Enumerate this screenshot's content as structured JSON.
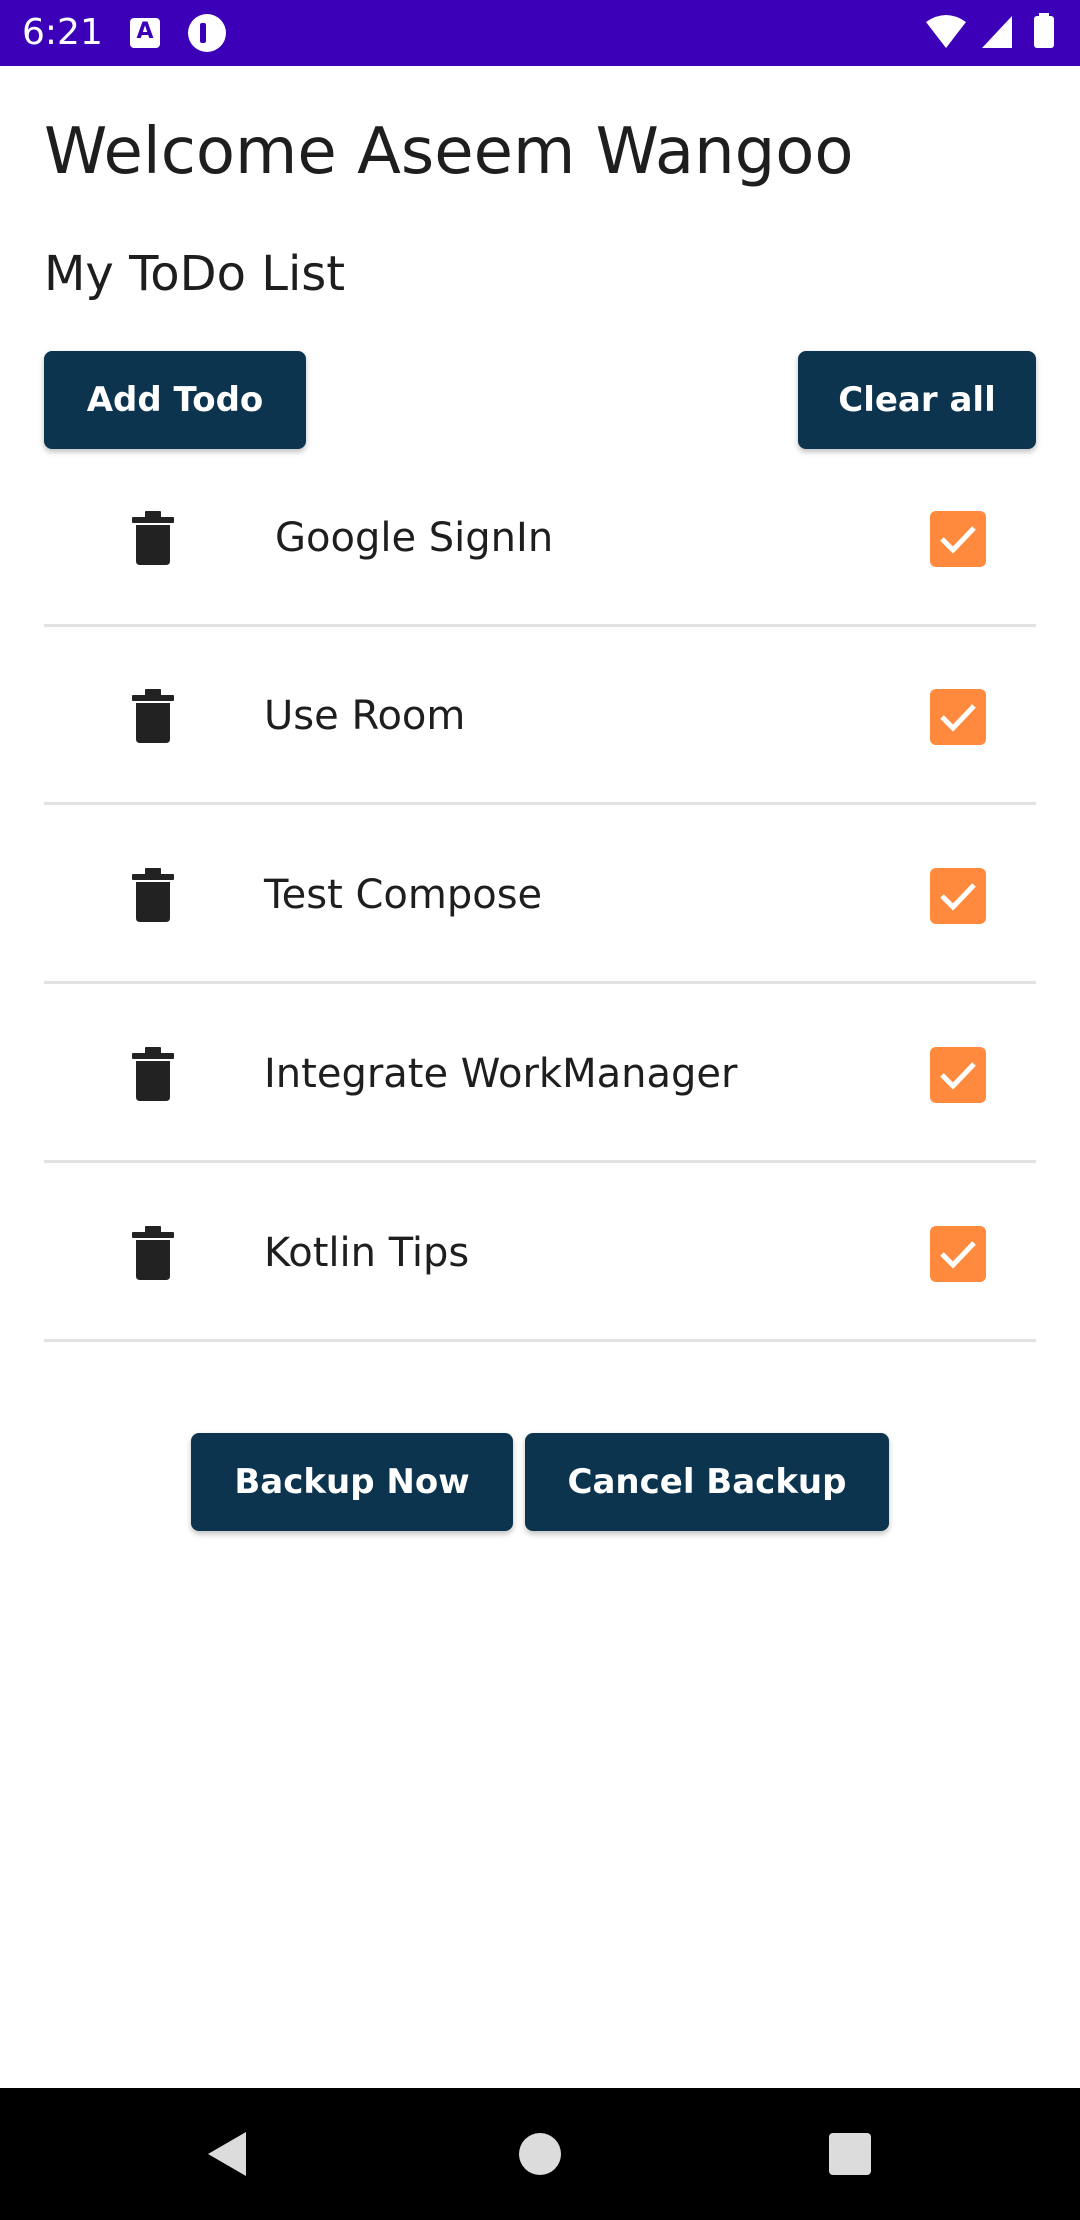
{
  "status_bar": {
    "time": "6:21",
    "bg_color": "#3b00b8",
    "icons": [
      "a-badge-icon",
      "app-badge-icon",
      "wifi-icon",
      "signal-icon",
      "battery-icon"
    ]
  },
  "header": {
    "welcome": "Welcome Aseem Wangoo",
    "subtitle": "My ToDo List"
  },
  "actions": {
    "add_label": "Add Todo",
    "clear_label": "Clear all"
  },
  "todos": [
    {
      "label": "Google SignIn",
      "checked": true
    },
    {
      "label": "Use Room",
      "checked": true
    },
    {
      "label": "Test Compose",
      "checked": true
    },
    {
      "label": "Integrate WorkManager",
      "checked": true
    },
    {
      "label": "Kotlin Tips",
      "checked": true
    }
  ],
  "backup": {
    "backup_label": "Backup Now",
    "cancel_label": "Cancel Backup"
  },
  "colors": {
    "button": "#0d344f",
    "checkbox": "#ff8a3d",
    "divider": "#e2e2e2"
  },
  "nav": {
    "icons": [
      "back-icon",
      "home-icon",
      "recents-icon"
    ]
  }
}
